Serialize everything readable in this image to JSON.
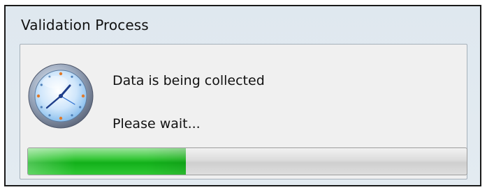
{
  "window": {
    "title": "Validation Process"
  },
  "dialog": {
    "icon": "clock-icon",
    "message_primary": "Data is being collected",
    "message_secondary": "Please wait..."
  },
  "progress": {
    "value": 0.36,
    "fill_color": "#1ab01f"
  }
}
